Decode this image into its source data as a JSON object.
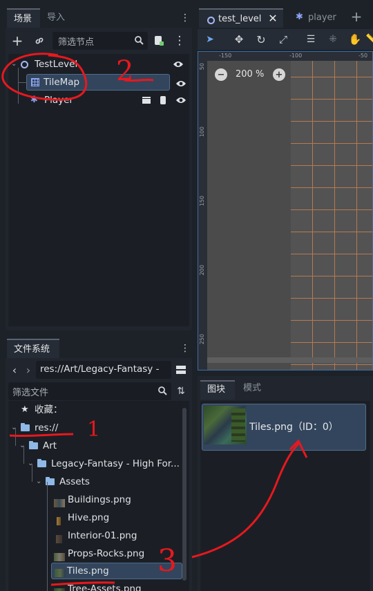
{
  "scene_dock": {
    "tabs": [
      {
        "label": "场景"
      },
      {
        "label": "导入"
      }
    ],
    "filter_placeholder": "筛选节点",
    "nodes": [
      {
        "label": "TestLevel"
      },
      {
        "label": "TileMap"
      },
      {
        "label": "Player"
      }
    ]
  },
  "filesystem_dock": {
    "tab": "文件系统",
    "path": "res://Art/Legacy-Fantasy -",
    "filter_placeholder": "筛选文件",
    "favorites": "收藏：",
    "tree": [
      {
        "label": "res://"
      },
      {
        "label": "Art"
      },
      {
        "label": "Legacy-Fantasy - High For..."
      },
      {
        "label": "Assets"
      },
      {
        "label": "Buildings.png"
      },
      {
        "label": "Hive.png"
      },
      {
        "label": "Interior-01.png"
      },
      {
        "label": "Props-Rocks.png"
      },
      {
        "label": "Tiles.png"
      },
      {
        "label": "Tree-Assets.png"
      }
    ]
  },
  "editor_tabs": [
    {
      "label": "test_level"
    },
    {
      "label": "player"
    }
  ],
  "viewport": {
    "zoom": "200 %",
    "ruler_x": [
      "-150",
      "-100",
      "-50"
    ],
    "ruler_y": [
      "50",
      "100",
      "150",
      "200",
      "250"
    ]
  },
  "tileset_panel": {
    "tabs": [
      {
        "label": "图块"
      },
      {
        "label": "模式"
      }
    ],
    "atlas_label": "Tiles.png（ID：0）"
  },
  "annotations": [
    "1",
    "2",
    "3"
  ]
}
